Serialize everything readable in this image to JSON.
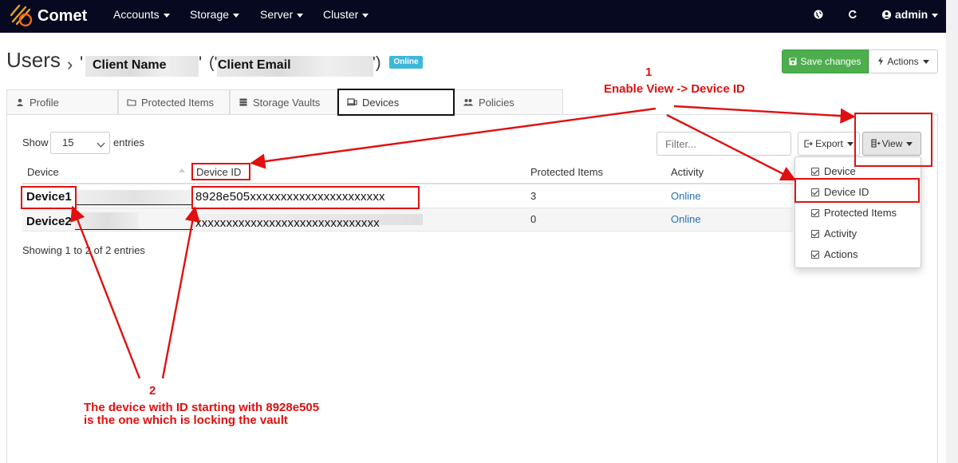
{
  "app": {
    "name": "Comet"
  },
  "nav": {
    "menus": [
      "Accounts",
      "Storage",
      "Server",
      "Cluster"
    ],
    "user": "admin"
  },
  "header": {
    "title": "Users",
    "client_name": "Client Name",
    "client_email": "Client Email",
    "status_badge": "Online",
    "save_label": "Save changes",
    "actions_label": "Actions"
  },
  "tabs": [
    {
      "label": "Profile"
    },
    {
      "label": "Protected Items"
    },
    {
      "label": "Storage Vaults"
    },
    {
      "label": "Devices",
      "active": true
    },
    {
      "label": "Policies"
    }
  ],
  "controls": {
    "show_label": "Show",
    "page_size": "15",
    "entries_label": "entries",
    "filter_placeholder": "Filter...",
    "export_label": "Export",
    "view_label": "View"
  },
  "table": {
    "columns": [
      "Device",
      "Device ID",
      "Protected Items",
      "Activity"
    ],
    "rows": [
      {
        "device": "Device1",
        "device_id": "8928e505xxxxxxxxxxxxxxxxxxxxxx",
        "protected_items": "3",
        "activity": "Online"
      },
      {
        "device": "Device2",
        "device_id": "xxxxxxxxxxxxxxxxxxxxxxxxxxxxxx",
        "protected_items": "0",
        "activity": "Online"
      }
    ],
    "footer": "Showing 1 to 2 of 2 entries"
  },
  "view_menu": {
    "items": [
      "Device",
      "Device ID",
      "Protected Items",
      "Activity",
      "Actions"
    ]
  },
  "annotations": {
    "step1_number": "1",
    "step1_text": "Enable View -> Device ID",
    "step2_number": "2",
    "step2_line1": "The device with ID starting with 8928e505",
    "step2_line2": "is the one which is locking the vault",
    "color": "#e01010"
  }
}
